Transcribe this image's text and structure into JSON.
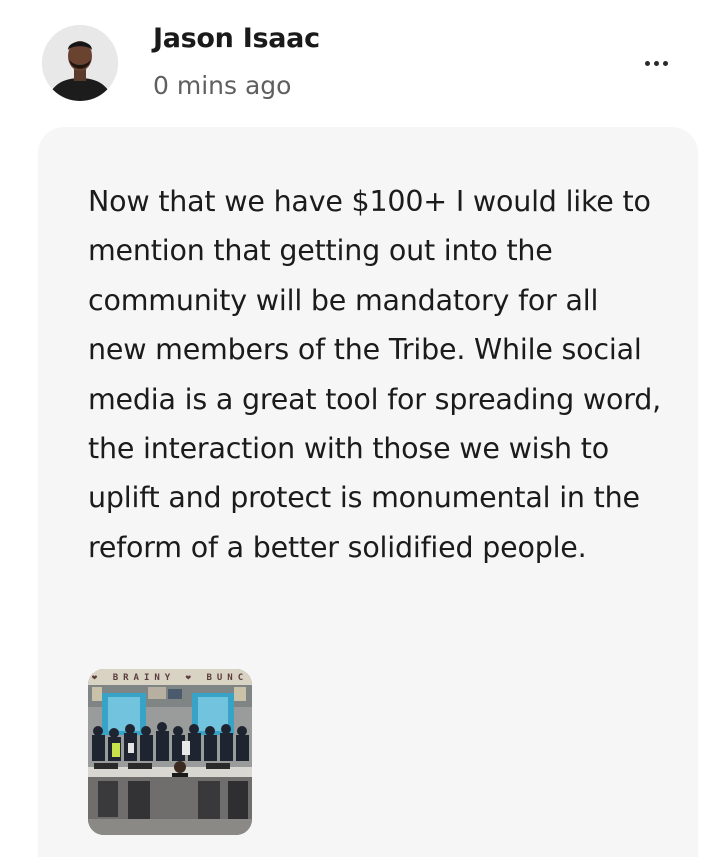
{
  "post": {
    "author": {
      "name": "Jason Isaac",
      "avatar_icon": "profile-photo"
    },
    "timestamp": "0 mins ago",
    "menu_icon": "more-horizontal-icon",
    "body": "Now that we have $100+ I would like to mention that getting out into the community will be mandatory for all new members of the Tribe. While social media is a great tool for spreading word, the interaction with those we wish to uplift and protect is monumental in the reform of a better solidified people.",
    "attachment": {
      "kind": "image",
      "banner_text": "❤ BRAINY ❤ BUNC"
    }
  },
  "colors": {
    "card_background": "#f6f6f6",
    "name_color": "#1a1a1a",
    "timestamp_color": "#5f5f5f"
  }
}
